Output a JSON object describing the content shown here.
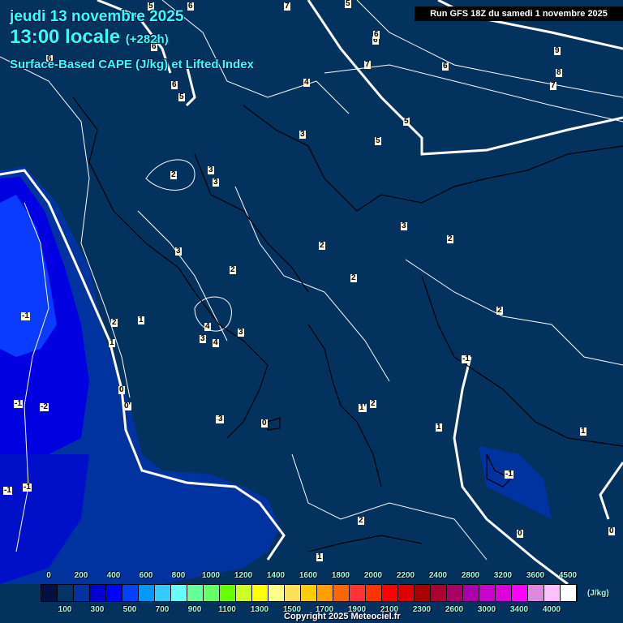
{
  "header": {
    "date": "jeudi 13 novembre 2025",
    "time": "13:00 locale",
    "lead": "(+282h)",
    "parameter": "Surface-Based CAPE (J/kg) et Lifted Index",
    "run": "Run GFS 18Z du samedi 1 novembre 2025"
  },
  "legend": {
    "unit": "(J/kg)",
    "values": [
      "0",
      "100",
      "200",
      "300",
      "400",
      "500",
      "600",
      "700",
      "800",
      "900",
      "1000",
      "1100",
      "1200",
      "1300",
      "1400",
      "1500",
      "1600",
      "1700",
      "1800",
      "1900",
      "2000",
      "2100",
      "2200",
      "2300",
      "2400",
      "2600",
      "2800",
      "3000",
      "3200",
      "3400",
      "3600",
      "4000",
      "4500"
    ],
    "colors": [
      "#001040",
      "#003366",
      "#0033a0",
      "#0000d0",
      "#0000ff",
      "#0040ff",
      "#0099ff",
      "#33ccff",
      "#66ffff",
      "#66ff99",
      "#66ff66",
      "#66ff00",
      "#ccff22",
      "#ffff00",
      "#ffff88",
      "#ffe055",
      "#ffcc00",
      "#ffa000",
      "#ff6600",
      "#ff3333",
      "#ff3300",
      "#ff0000",
      "#dd0000",
      "#aa0000",
      "#aa0033",
      "#aa0066",
      "#aa00aa",
      "#cc00cc",
      "#dd00dd",
      "#ff00ff",
      "#dd88dd",
      "#ffc0ff",
      "#ffffff"
    ]
  },
  "lifted_index_labels": [
    "5",
    "6",
    "6",
    "7",
    "6",
    "5",
    "6",
    "5",
    "6",
    "4",
    "6",
    "7",
    "6",
    "9",
    "8",
    "7",
    "5",
    "5",
    "3",
    "2",
    "3",
    "3",
    "3",
    "2",
    "2",
    "3",
    "2",
    "2",
    "2",
    "4",
    "3",
    "3",
    "4",
    "3",
    "2",
    "1",
    "-1",
    "-1",
    "-2",
    "0",
    "0'",
    "0",
    "1'",
    "2",
    "1",
    "1",
    "1",
    "-1",
    "-1",
    "-1",
    "-1",
    "2",
    "1",
    "0",
    "0",
    "3"
  ],
  "copyright": "Copyright 2025 Meteociel.fr"
}
